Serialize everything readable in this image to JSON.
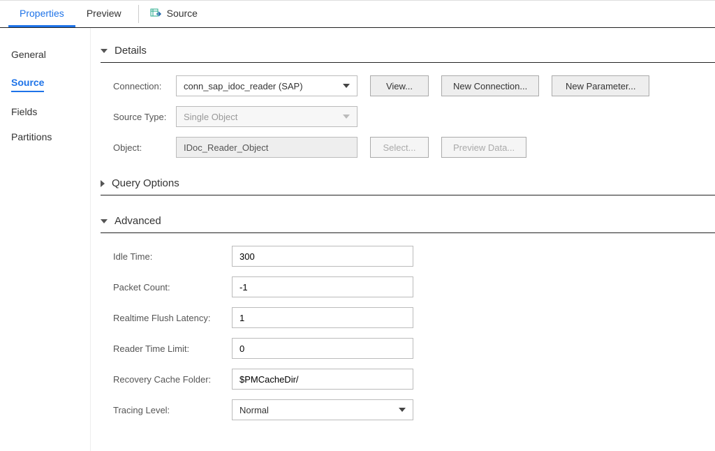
{
  "topTabs": {
    "properties": "Properties",
    "preview": "Preview",
    "source": "Source"
  },
  "sidebar": {
    "general": "General",
    "source": "Source",
    "fields": "Fields",
    "partitions": "Partitions"
  },
  "sections": {
    "details": "Details",
    "queryOptions": "Query Options",
    "advanced": "Advanced"
  },
  "details": {
    "connectionLabel": "Connection:",
    "connectionValue": "conn_sap_idoc_reader (SAP)",
    "viewBtn": "View...",
    "newConnBtn": "New Connection...",
    "newParamBtn": "New Parameter...",
    "sourceTypeLabel": "Source Type:",
    "sourceTypeValue": "Single Object",
    "objectLabel": "Object:",
    "objectValue": "IDoc_Reader_Object",
    "selectBtn": "Select...",
    "previewDataBtn": "Preview Data..."
  },
  "advanced": {
    "idleTimeLabel": "Idle Time:",
    "idleTimeValue": "300",
    "packetCountLabel": "Packet Count:",
    "packetCountValue": "-1",
    "flushLatencyLabel": "Realtime Flush Latency:",
    "flushLatencyValue": "1",
    "readerTimeLimitLabel": "Reader Time Limit:",
    "readerTimeLimitValue": "0",
    "recoveryCacheLabel": "Recovery Cache Folder:",
    "recoveryCacheValue": "$PMCacheDir/",
    "tracingLevelLabel": "Tracing Level:",
    "tracingLevelValue": "Normal"
  }
}
